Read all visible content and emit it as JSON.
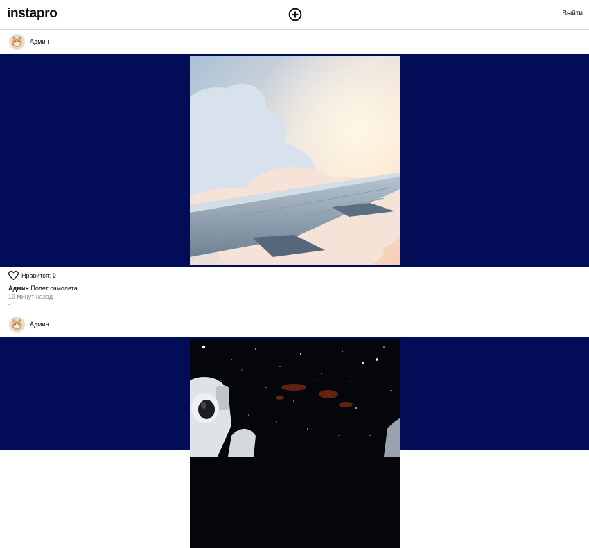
{
  "header": {
    "logo": "instapro",
    "add_icon": "plus-circle-icon",
    "logout_label": "Выйти"
  },
  "posts": [
    {
      "author": "Админ",
      "image_description": "airplane-wing-clouds",
      "likes_label": "Нравится:",
      "likes_count": "0",
      "caption_author": "Админ",
      "caption_text": "Полет самолета",
      "time_ago": "19 минут назад",
      "extra": "."
    },
    {
      "author": "Админ",
      "image_description": "astronaut-space"
    }
  ],
  "colors": {
    "image_band": "#030c56",
    "text": "#111111",
    "muted": "#8a8a8a"
  }
}
